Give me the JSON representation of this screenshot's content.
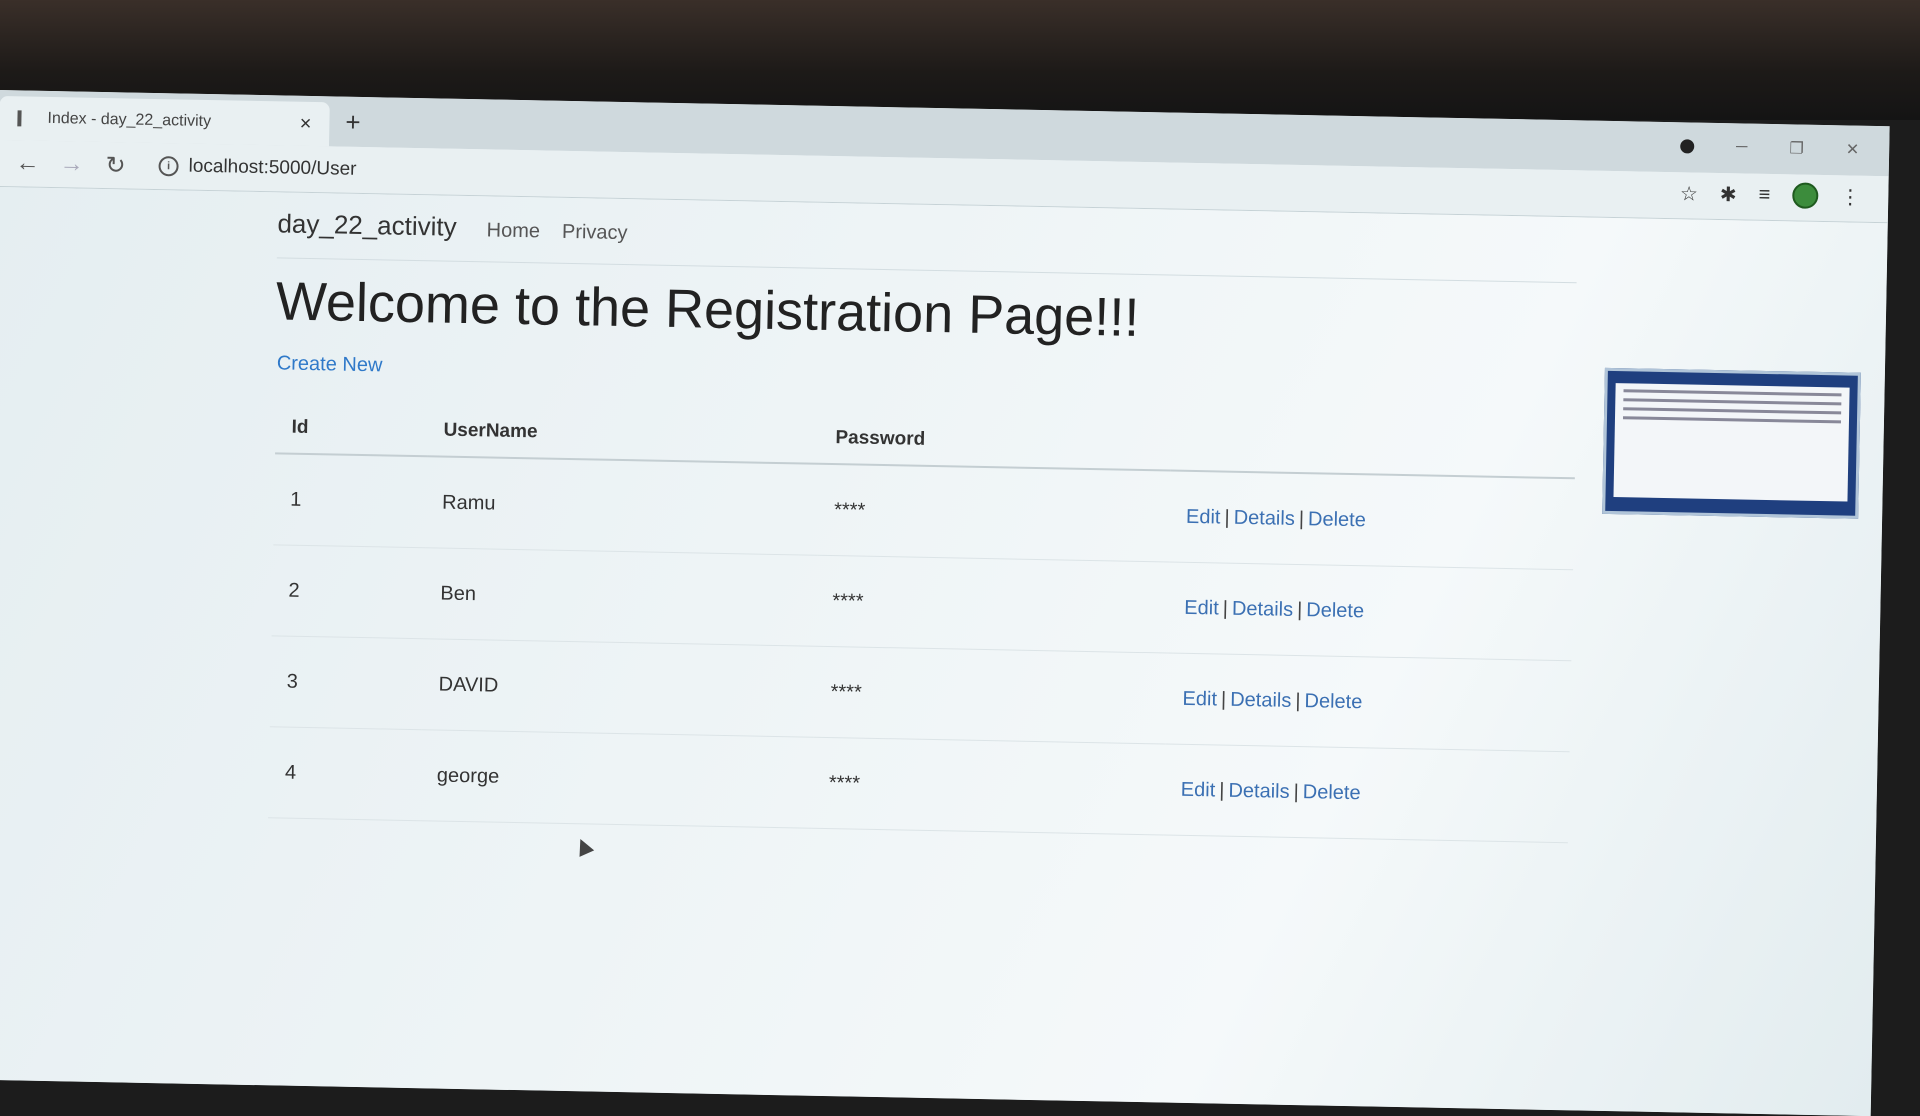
{
  "browser": {
    "tab_title": "Index - day_22_activity",
    "tab_close": "×",
    "new_tab": "+",
    "url": "localhost:5000/User"
  },
  "navbar": {
    "brand": "day_22_activity",
    "links": [
      "Home",
      "Privacy"
    ]
  },
  "page": {
    "heading": "Welcome to the Registration Page!!!",
    "create_new": "Create New"
  },
  "table": {
    "headers": [
      "Id",
      "UserName",
      "Password"
    ],
    "rows": [
      {
        "id": "1",
        "username": "Ramu",
        "password": "****"
      },
      {
        "id": "2",
        "username": "Ben",
        "password": "****"
      },
      {
        "id": "3",
        "username": "DAVID",
        "password": "****"
      },
      {
        "id": "4",
        "username": "george",
        "password": "****"
      }
    ],
    "actions": {
      "edit": "Edit",
      "details": "Details",
      "delete": "Delete",
      "separator": "|"
    }
  },
  "colors": {
    "link": "#2f79c9",
    "action_link": "#3b70b3"
  },
  "icons": [
    "back-arrow-icon",
    "forward-arrow-icon",
    "reload-icon",
    "info-icon",
    "star-icon",
    "extensions-icon",
    "reading-list-icon",
    "profile-avatar",
    "menu-icon",
    "record-icon",
    "minimize-icon",
    "maximize-icon",
    "close-window-icon"
  ]
}
